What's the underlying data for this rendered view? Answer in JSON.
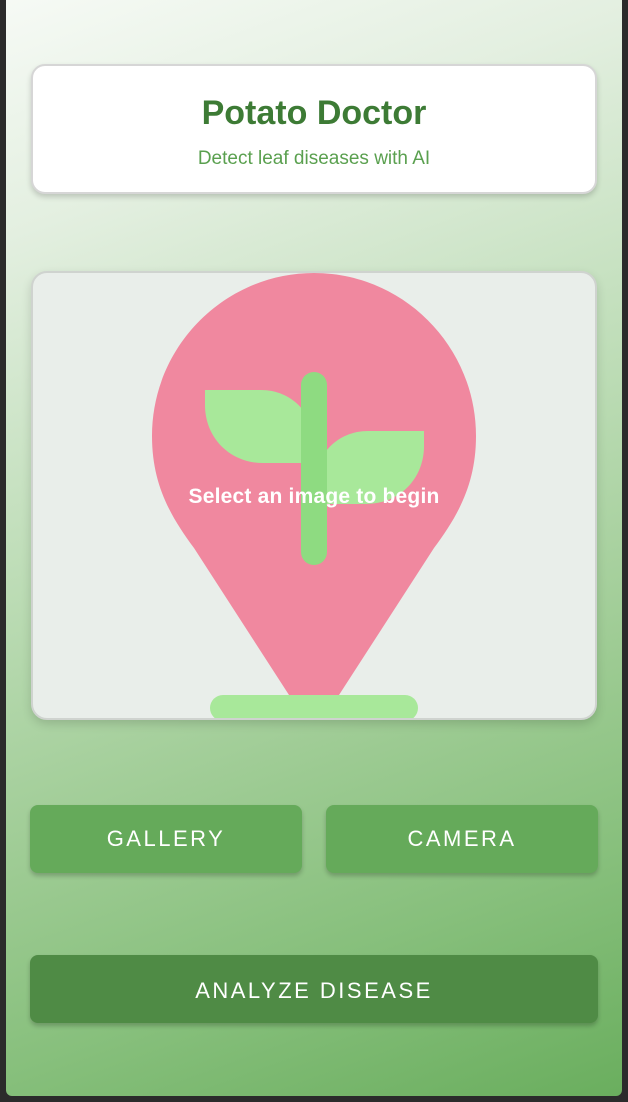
{
  "header": {
    "title": "Potato Doctor",
    "subtitle": "Detect leaf diseases with AI"
  },
  "image_preview": {
    "placeholder_text": "Select an image to begin",
    "icon": "plant-pin-icon",
    "colors": {
      "pin": "#f0889f",
      "leaf": "#a8e89a",
      "stem": "#8edb81"
    }
  },
  "actions": {
    "gallery_label": "GALLERY",
    "camera_label": "CAMERA",
    "analyze_label": "ANALYZE DISEASE"
  },
  "colors": {
    "title": "#3d7b35",
    "primary_button": "#65aa5a",
    "analyze_button": "#4f8b45"
  }
}
